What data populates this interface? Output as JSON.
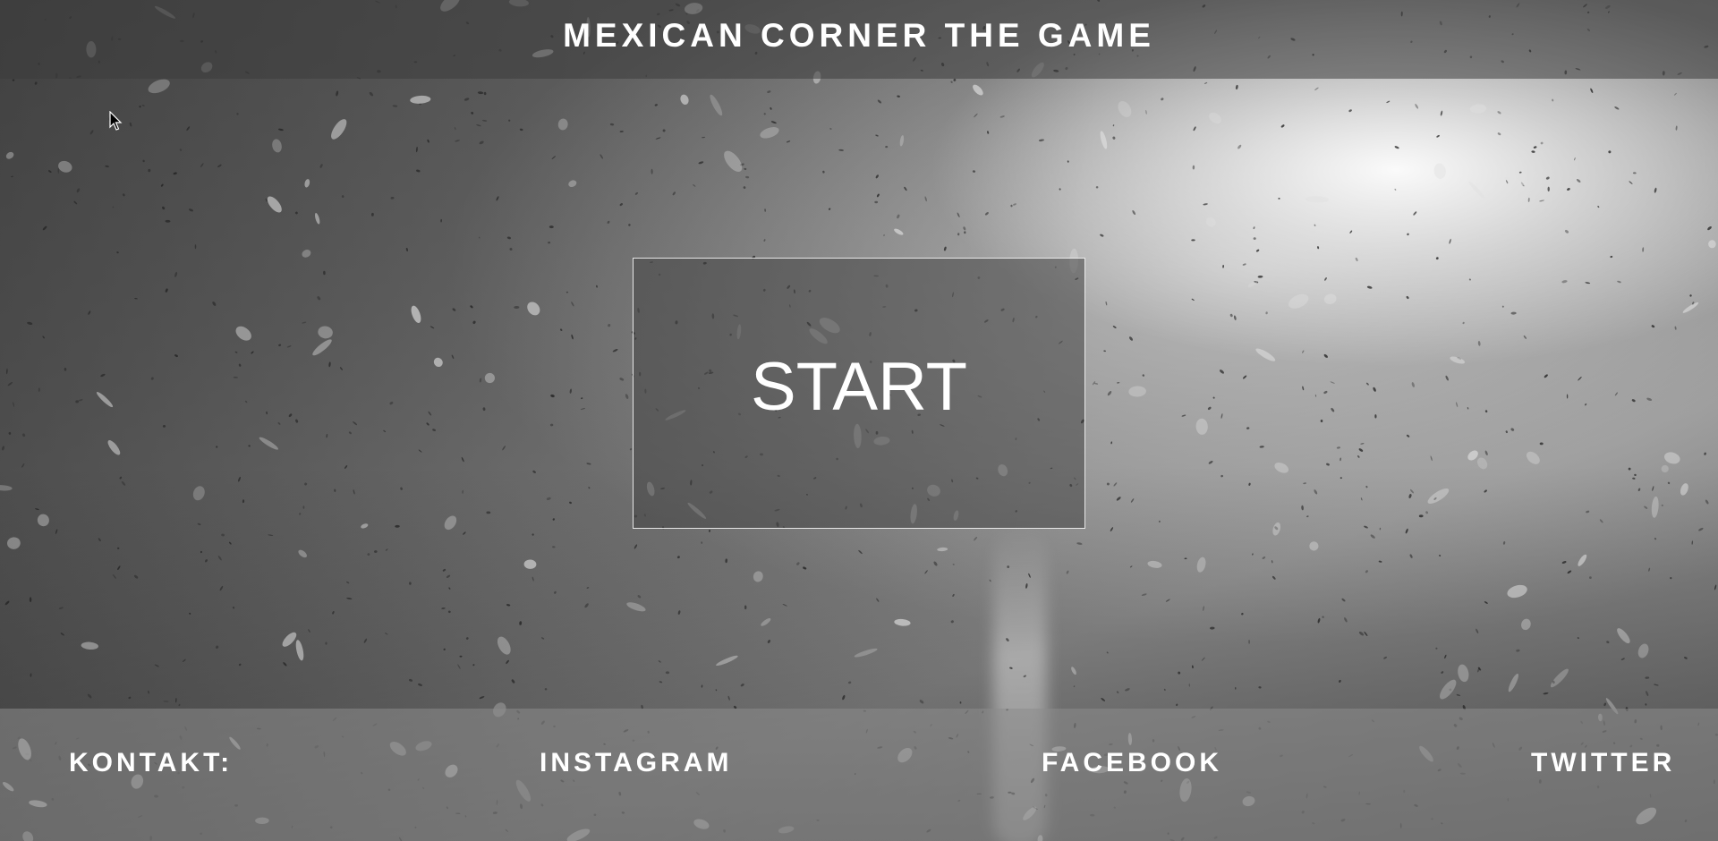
{
  "header": {
    "title": "MEXICAN CORNER THE GAME"
  },
  "main": {
    "start_label": "START"
  },
  "footer": {
    "contact_label": "KONTAKT:",
    "links": [
      "INSTAGRAM",
      "FACEBOOK",
      "TWITTER"
    ]
  },
  "icons": {
    "cursor": "arrow-cursor-icon"
  },
  "colors": {
    "text": "#ffffff",
    "background": "#7a7a7a"
  }
}
